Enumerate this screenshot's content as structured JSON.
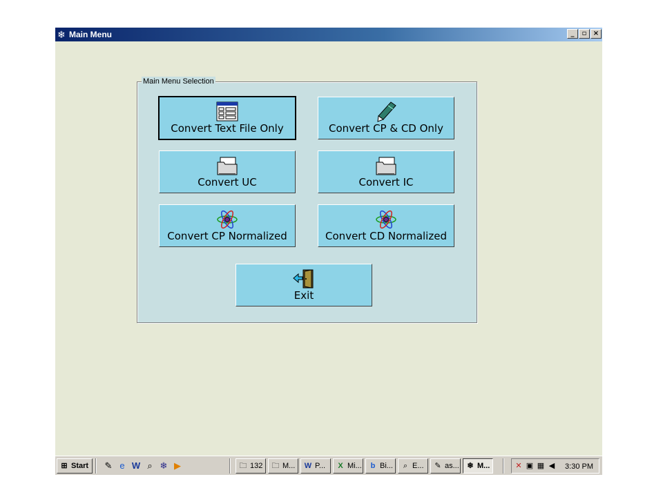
{
  "window": {
    "title": "Main Menu",
    "icon": "snowflake-icon",
    "controls": {
      "minimize": "_",
      "maximize": "▫",
      "close": "×"
    }
  },
  "group": {
    "label": "Main Menu Selection"
  },
  "buttons": {
    "convert_text": {
      "label": "Convert Text File Only",
      "icon": "form-list-icon"
    },
    "convert_cp_cd": {
      "label": "Convert CP & CD Only",
      "icon": "pen-icon"
    },
    "convert_uc": {
      "label": "Convert UC",
      "icon": "folder-icon"
    },
    "convert_ic": {
      "label": "Convert IC",
      "icon": "folder-icon"
    },
    "convert_cp_norm": {
      "label": "Convert CP Normalized",
      "icon": "atom-icon"
    },
    "convert_cd_norm": {
      "label": "Convert CD Normalized",
      "icon": "atom-icon"
    },
    "exit": {
      "label": "Exit",
      "icon": "exit-door-icon"
    }
  },
  "taskbar": {
    "start_label": "Start",
    "tasks": [
      {
        "label": "132",
        "icon": "folder-icon"
      },
      {
        "label": "M...",
        "icon": "folder-icon"
      },
      {
        "label": "P...",
        "icon": "word-icon"
      },
      {
        "label": "Mi...",
        "icon": "excel-icon"
      },
      {
        "label": "Bi...",
        "icon": "b-app-icon"
      },
      {
        "label": "E...",
        "icon": "explorer-icon"
      },
      {
        "label": "as...",
        "icon": "notepad-icon"
      },
      {
        "label": "M...",
        "icon": "snowflake-icon"
      }
    ],
    "clock": "3:30 PM"
  },
  "colors": {
    "title_bar": "#0a246a",
    "client_bg": "#e6e9d6",
    "group_bg": "#c8dfe1",
    "button_bg": "#8dd3e7",
    "taskbar_bg": "#d4d0c8"
  }
}
